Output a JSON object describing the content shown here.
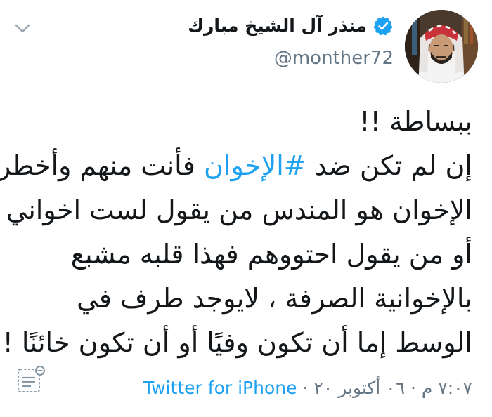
{
  "header": {
    "display_name": "منذر آل الشيخ مبارك",
    "handle": "@monther72",
    "verified": true,
    "avatar": "profile-photo"
  },
  "tweet": {
    "line1": "ببساطة !!",
    "line2_prefix": "إن لم تكن ضد ",
    "line2_hashtag": "#الإخوان",
    "line2_suffix": " فأنت منهم وأخطر",
    "line3": "الإخوان هو المندس من يقول لست اخواني",
    "line4": "أو من يقول احتووهم فهذا قلبه مشبع",
    "line5": "بالإخوانية الصرفة ، لايوجد طرف في",
    "line6": "الوسط إما أن تكون وفيًا أو أن تكون خائنًا !!"
  },
  "footer": {
    "timestamp": "٧:٠٧ م · ٠٦ أكتوبر ٢٠ · ",
    "source": "Twitter for iPhone"
  },
  "colors": {
    "link": "#1da1f2",
    "secondary": "#657786",
    "text": "#14171a"
  },
  "icons": {
    "menu": "chevron-down-icon",
    "verified": "verified-badge-icon",
    "thread": "thread-view-icon"
  }
}
